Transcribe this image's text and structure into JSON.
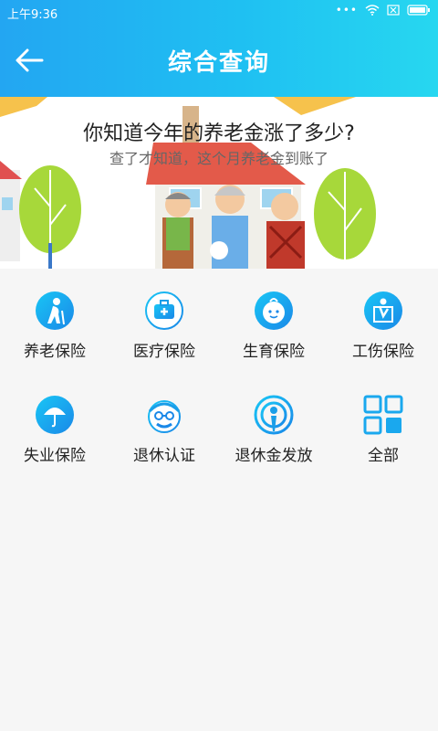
{
  "status": {
    "time": "上午9:36",
    "dots": "•••"
  },
  "nav": {
    "title": "综合查询"
  },
  "banner": {
    "title": "你知道今年的养老金涨了多少?",
    "subtitle": "查了才知道，这个月养老金到账了"
  },
  "grid": {
    "items": [
      {
        "label": "养老保险",
        "icon": "elderly-icon"
      },
      {
        "label": "医疗保险",
        "icon": "medical-kit-icon"
      },
      {
        "label": "生育保险",
        "icon": "baby-face-icon"
      },
      {
        "label": "工伤保险",
        "icon": "injury-icon"
      },
      {
        "label": "失业保险",
        "icon": "umbrella-icon"
      },
      {
        "label": "退休认证",
        "icon": "elder-glasses-icon"
      },
      {
        "label": "退休金发放",
        "icon": "broadcast-icon"
      },
      {
        "label": "全部",
        "icon": "grid-icon"
      }
    ]
  },
  "colors": {
    "accent": "#1fb6f2",
    "icon_gradient_start": "#19c6f5",
    "icon_gradient_end": "#1a88e8"
  }
}
